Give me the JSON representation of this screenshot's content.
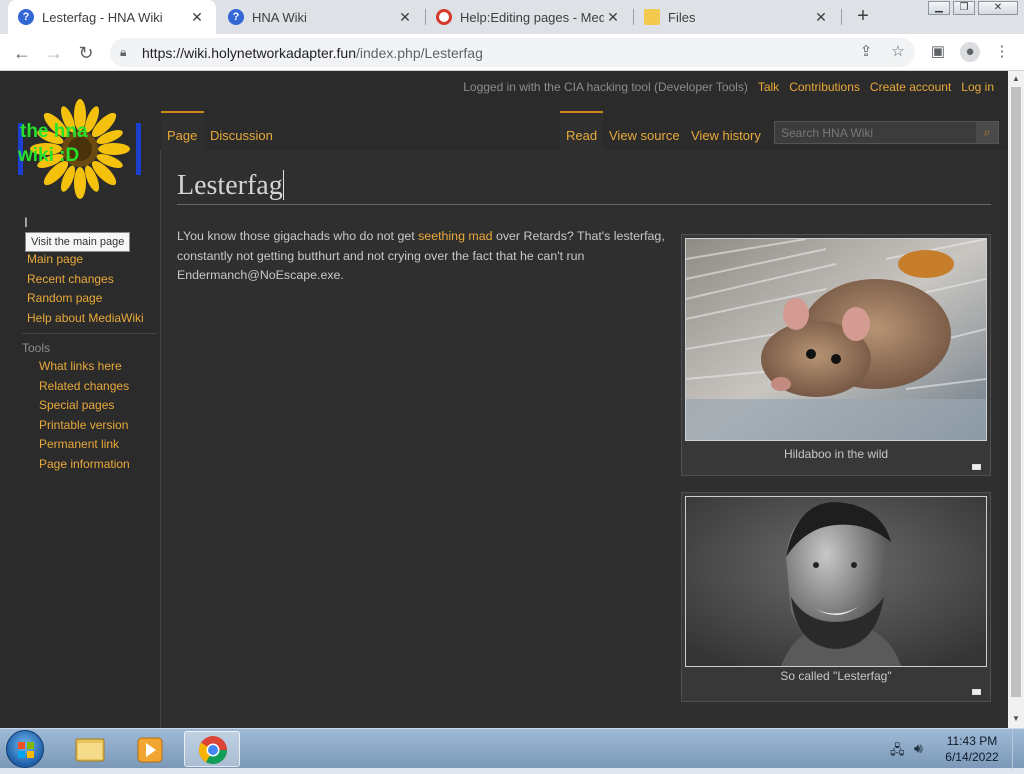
{
  "browser": {
    "tabs": [
      {
        "title": "Lesterfag - HNA Wiki",
        "active": true,
        "favicon": "help-circle-icon",
        "favicon_color": "#3367d6"
      },
      {
        "title": "HNA Wiki",
        "active": false,
        "favicon": "help-circle-icon",
        "favicon_color": "#3367d6"
      },
      {
        "title": "Help:Editing pages - Media",
        "active": false,
        "favicon": "mediawiki-icon",
        "favicon_color": "#d33a2c"
      },
      {
        "title": "Files",
        "active": false,
        "favicon": "folder-icon",
        "favicon_color": "#f2c94c"
      }
    ],
    "close_glyph": "✕",
    "new_tab_glyph": "+",
    "url_host": "https://wiki.holynetworkadapter.fun",
    "url_path": "/index.php/Lesterfag"
  },
  "wiki": {
    "personal": {
      "logged_in": "Logged in with the CIA hacking tool (Developer Tools)",
      "talk": "Talk",
      "contributions": "Contributions",
      "create_account": "Create account",
      "log_in": "Log in"
    },
    "namespaces": {
      "page": "Page",
      "discussion": "Discussion"
    },
    "views": {
      "read": "Read",
      "view_source": "View source",
      "view_history": "View history"
    },
    "search_placeholder": "Search HNA Wiki",
    "logo_text_line1": "the hna",
    "logo_text_line2": "wiki :D",
    "tooltip": "Visit the main page",
    "navigation": [
      "Main page",
      "Recent changes",
      "Random page",
      "Help about MediaWiki"
    ],
    "tools_heading": "Tools",
    "tools": [
      "What links here",
      "Related changes",
      "Special pages",
      "Printable version",
      "Permanent link",
      "Page information"
    ],
    "title": "Lesterfag",
    "body": {
      "p1": "LYou know those gigachads who do not get ",
      "link1": "seething mad",
      "p2": " over Retards? That's lesterfag, constantly not getting butthurt and not crying over the fact that he can't run Endermanch@NoEscape.exe."
    },
    "thumbs": [
      {
        "caption": "Hildaboo in the wild",
        "image": "rat-in-cage-photo"
      },
      {
        "caption": "So called \"Lesterfag\"",
        "image": "gigachad-photo"
      }
    ]
  },
  "taskbar": {
    "time": "11:43 PM",
    "date": "6/14/2022"
  }
}
